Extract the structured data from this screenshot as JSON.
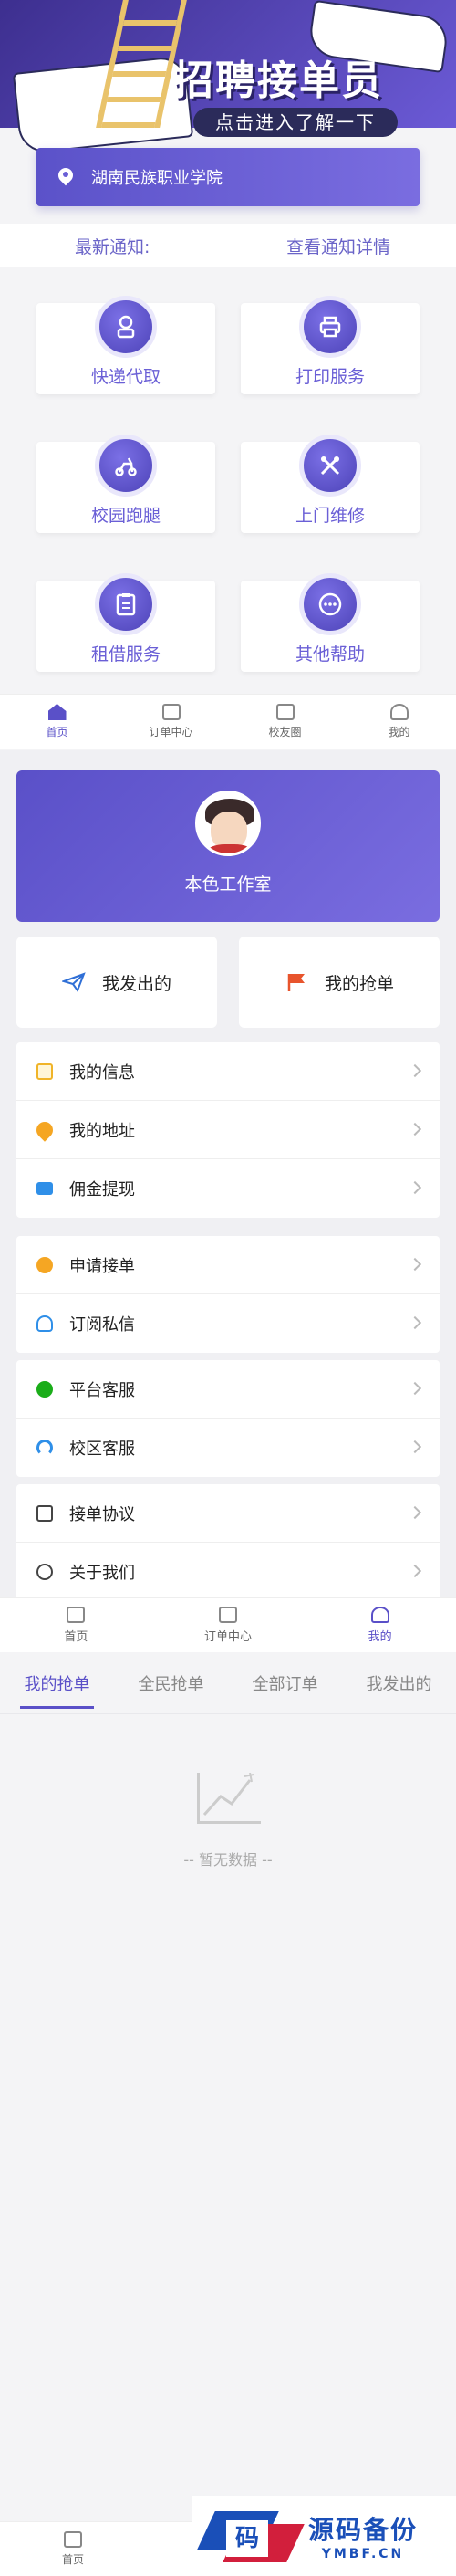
{
  "home": {
    "banner": {
      "title": "招聘接单员",
      "subtitle": "点击进入了解一下"
    },
    "location": "湖南民族职业学院",
    "notice": {
      "label": "最新通知:",
      "link": "查看通知详情"
    },
    "services": [
      {
        "label": "快递代取",
        "icon": "courier-icon"
      },
      {
        "label": "打印服务",
        "icon": "printer-icon"
      },
      {
        "label": "校园跑腿",
        "icon": "scooter-icon"
      },
      {
        "label": "上门维修",
        "icon": "tools-icon"
      },
      {
        "label": "租借服务",
        "icon": "rent-icon"
      },
      {
        "label": "其他帮助",
        "icon": "more-icon"
      }
    ],
    "tabbar": [
      "首页",
      "订单中心",
      "校友圈",
      "我的"
    ]
  },
  "mine": {
    "profile_name": "本色工作室",
    "actions": {
      "sent": "我发出的",
      "grabbed": "我的抢单"
    },
    "groups": [
      [
        {
          "label": "我的信息",
          "icon": "info-icon",
          "color": "#f0b429"
        },
        {
          "label": "我的地址",
          "icon": "location-icon",
          "color": "#f5a623"
        },
        {
          "label": "佣金提现",
          "icon": "card-icon",
          "color": "#2f8fe8"
        }
      ],
      [
        {
          "label": "申请接单",
          "icon": "apply-icon",
          "color": "#f5a623"
        },
        {
          "label": "订阅私信",
          "icon": "bell-icon",
          "color": "#2f8fe8"
        }
      ],
      [
        {
          "label": "平台客服",
          "icon": "wechat-icon",
          "color": "#1aad19"
        },
        {
          "label": "校区客服",
          "icon": "headset-icon",
          "color": "#2f8fe8"
        }
      ],
      [
        {
          "label": "接单协议",
          "icon": "document-icon",
          "color": "#444444"
        },
        {
          "label": "关于我们",
          "icon": "about-icon",
          "color": "#444444"
        }
      ]
    ],
    "tabbar": [
      "首页",
      "订单中心",
      "我的"
    ]
  },
  "orders": {
    "tabs": [
      "我的抢单",
      "全民抢单",
      "全部订单",
      "我发出的"
    ],
    "empty_text": "-- 暂无数据 --",
    "tabbar": [
      "首页"
    ]
  },
  "watermark": {
    "logo_char": "码",
    "title": "源码备份",
    "domain": "YMBF.CN"
  },
  "colors": {
    "accent": "#5a50c8",
    "accent_light": "#7a6de0",
    "bg": "#f4f4f6"
  }
}
